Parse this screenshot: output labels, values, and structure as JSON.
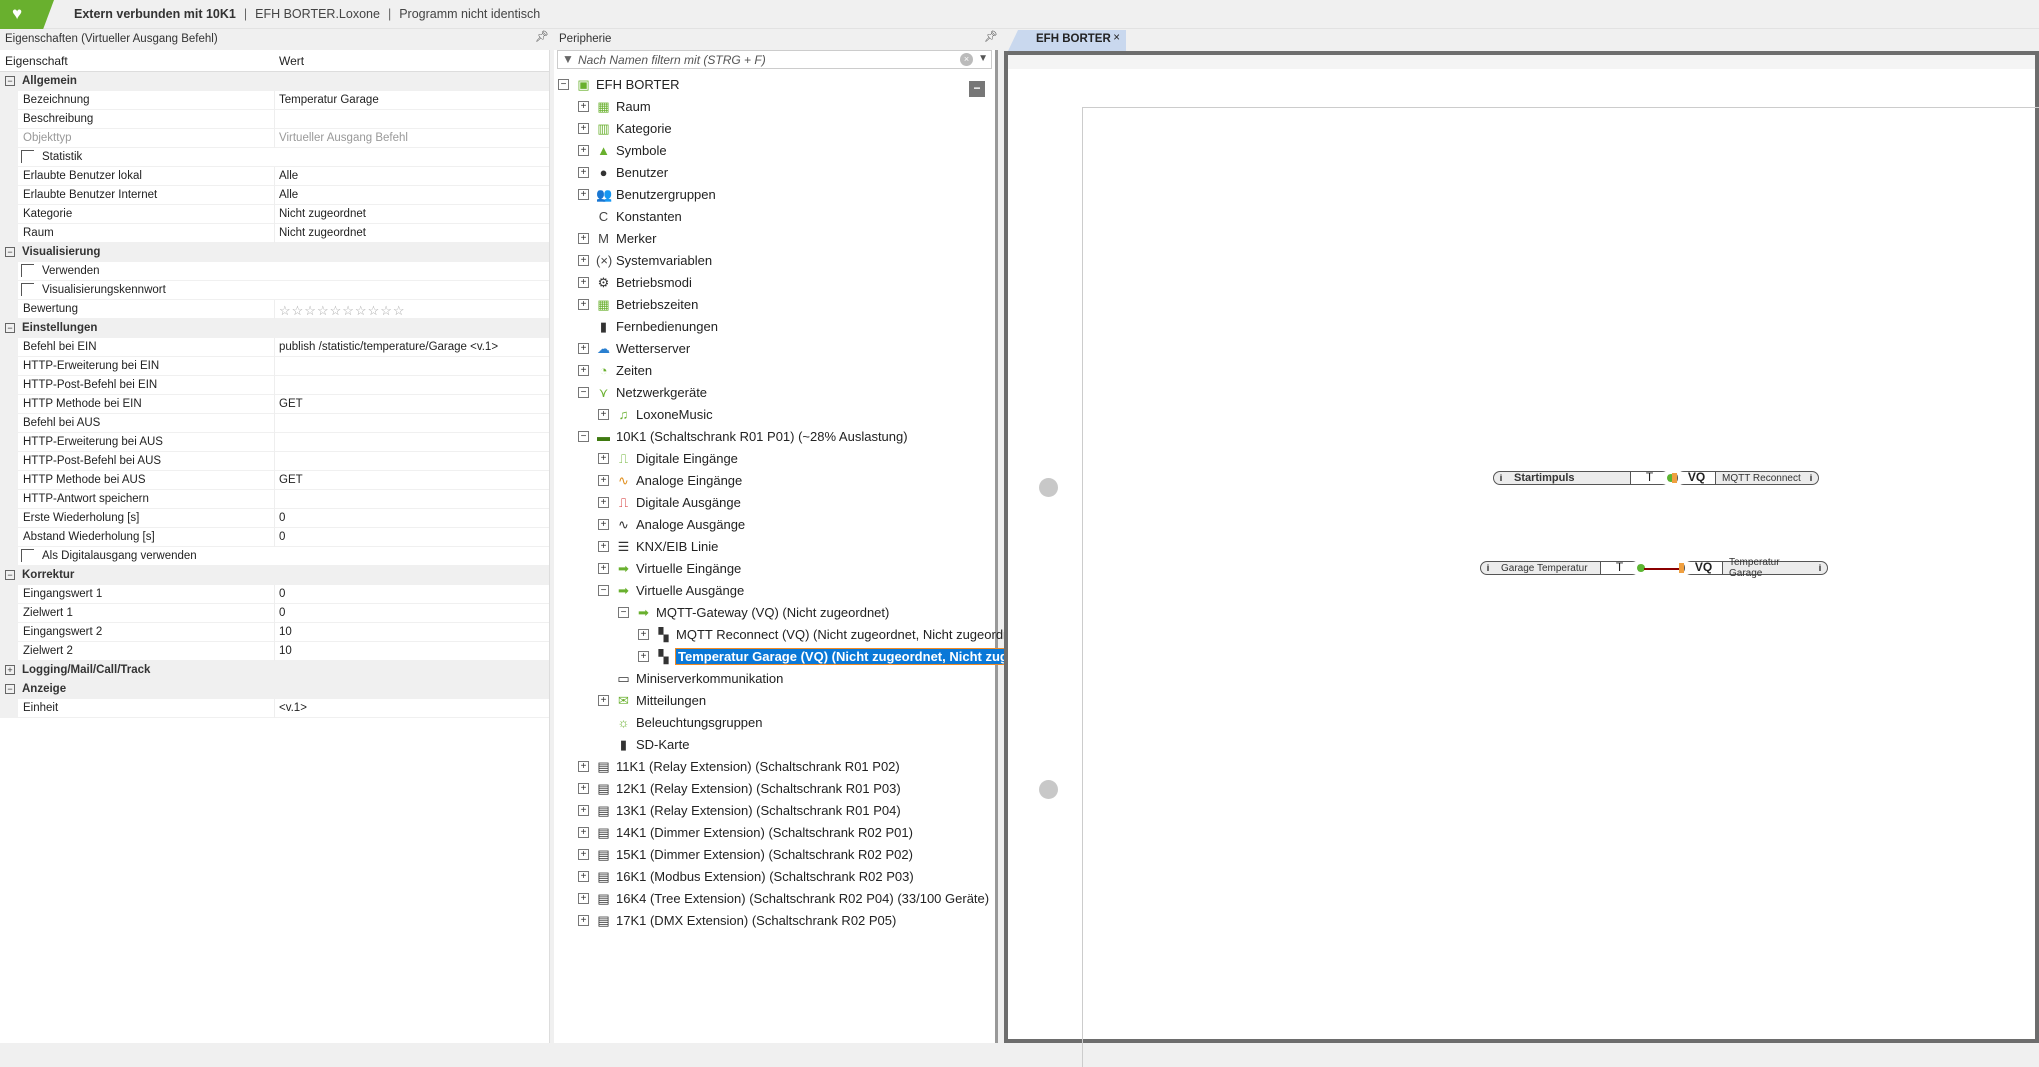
{
  "topbar": {
    "connection": "Extern verbunden mit 10K1",
    "file": "EFH BORTER.Loxone",
    "program_state": "Programm nicht identisch",
    "separator": "|"
  },
  "properties": {
    "title": "Eigenschaften (Virtueller Ausgang Befehl)",
    "col_name": "Eigenschaft",
    "col_value": "Wert",
    "rows": [
      {
        "type": "group",
        "label": "Allgemein",
        "expander": "−"
      },
      {
        "type": "prop",
        "label": "Bezeichnung",
        "value": "Temperatur Garage"
      },
      {
        "type": "prop",
        "label": "Beschreibung",
        "value": ""
      },
      {
        "type": "prop",
        "label": "Objekttyp",
        "value": "Virtueller Ausgang Befehl",
        "disabled": true
      },
      {
        "type": "check",
        "label": "Statistik",
        "checked": false
      },
      {
        "type": "prop",
        "label": "Erlaubte Benutzer lokal",
        "value": "Alle"
      },
      {
        "type": "prop",
        "label": "Erlaubte Benutzer Internet",
        "value": "Alle"
      },
      {
        "type": "prop",
        "label": "Kategorie",
        "value": "Nicht zugeordnet"
      },
      {
        "type": "prop",
        "label": "Raum",
        "value": "Nicht zugeordnet"
      },
      {
        "type": "group",
        "label": "Visualisierung",
        "expander": "−"
      },
      {
        "type": "check",
        "label": "Verwenden",
        "checked": false
      },
      {
        "type": "check",
        "label": "Visualisierungskennwort",
        "checked": false
      },
      {
        "type": "prop",
        "label": "Bewertung",
        "value": "☆☆☆☆☆☆☆☆☆☆",
        "rating": 0,
        "rating_max": 10
      },
      {
        "type": "group",
        "label": "Einstellungen",
        "expander": "−"
      },
      {
        "type": "prop",
        "label": "Befehl bei EIN",
        "value": "publish /statistic/temperature/Garage <v.1>"
      },
      {
        "type": "prop",
        "label": "HTTP-Erweiterung bei EIN",
        "value": ""
      },
      {
        "type": "prop",
        "label": "HTTP-Post-Befehl bei EIN",
        "value": ""
      },
      {
        "type": "prop",
        "label": "HTTP Methode bei EIN",
        "value": "GET"
      },
      {
        "type": "prop",
        "label": "Befehl bei AUS",
        "value": ""
      },
      {
        "type": "prop",
        "label": "HTTP-Erweiterung bei AUS",
        "value": ""
      },
      {
        "type": "prop",
        "label": "HTTP-Post-Befehl bei AUS",
        "value": ""
      },
      {
        "type": "prop",
        "label": "HTTP Methode bei AUS",
        "value": "GET"
      },
      {
        "type": "prop",
        "label": "HTTP-Antwort speichern",
        "value": ""
      },
      {
        "type": "prop",
        "label": "Erste Wiederholung [s]",
        "value": "0"
      },
      {
        "type": "prop",
        "label": "Abstand Wiederholung [s]",
        "value": "0"
      },
      {
        "type": "check",
        "label": "Als Digitalausgang verwenden",
        "checked": false
      },
      {
        "type": "group",
        "label": "Korrektur",
        "expander": "−"
      },
      {
        "type": "prop",
        "label": "Eingangswert 1",
        "value": "0"
      },
      {
        "type": "prop",
        "label": "Zielwert 1",
        "value": "0"
      },
      {
        "type": "prop",
        "label": "Eingangswert 2",
        "value": "10"
      },
      {
        "type": "prop",
        "label": "Zielwert 2",
        "value": "10"
      },
      {
        "type": "group",
        "label": "Logging/Mail/Call/Track",
        "expander": "+"
      },
      {
        "type": "group",
        "label": "Anzeige",
        "expander": "−"
      },
      {
        "type": "prop",
        "label": "Einheit",
        "value": "<v.1>"
      }
    ]
  },
  "peripherie": {
    "title": "Peripherie",
    "filter_placeholder": "Nach Namen filtern mit (STRG + F)",
    "items": [
      {
        "d": 0,
        "x": "−",
        "icon": "project-icon",
        "g": "▣",
        "c": "#69b02e",
        "label": "EFH BORTER"
      },
      {
        "d": 1,
        "x": "+",
        "icon": "room-icon",
        "g": "▦",
        "c": "#69b02e",
        "label": "Raum"
      },
      {
        "d": 1,
        "x": "+",
        "icon": "category-icon",
        "g": "▥",
        "c": "#69b02e",
        "label": "Kategorie"
      },
      {
        "d": 1,
        "x": "+",
        "icon": "symbols-icon",
        "g": "▲",
        "c": "#69b02e",
        "label": "Symbole"
      },
      {
        "d": 1,
        "x": "+",
        "icon": "user-icon",
        "g": "●",
        "c": "#333",
        "label": "Benutzer"
      },
      {
        "d": 1,
        "x": "+",
        "icon": "user-group-icon",
        "g": "👥",
        "c": "#333",
        "label": "Benutzergruppen"
      },
      {
        "d": 1,
        "x": "",
        "icon": "constant-icon",
        "g": "C",
        "c": "#444",
        "label": "Konstanten"
      },
      {
        "d": 1,
        "x": "+",
        "icon": "flag-icon",
        "g": "M",
        "c": "#444",
        "label": "Merker"
      },
      {
        "d": 1,
        "x": "+",
        "icon": "system-variable-icon",
        "g": "(×)",
        "c": "#444",
        "label": "Systemvariablen"
      },
      {
        "d": 1,
        "x": "+",
        "icon": "gear-icon",
        "g": "⚙",
        "c": "#333",
        "label": "Betriebsmodi"
      },
      {
        "d": 1,
        "x": "+",
        "icon": "calendar-icon",
        "g": "▦",
        "c": "#69b02e",
        "label": "Betriebszeiten"
      },
      {
        "d": 1,
        "x": "",
        "icon": "remote-icon",
        "g": "▮",
        "c": "#333",
        "label": "Fernbedienungen"
      },
      {
        "d": 1,
        "x": "+",
        "icon": "weather-icon",
        "g": "☁",
        "c": "#2a7fd0",
        "label": "Wetterserver"
      },
      {
        "d": 1,
        "x": "+",
        "icon": "clock-icon",
        "g": "◔",
        "c": "#69b02e",
        "label": "Zeiten"
      },
      {
        "d": 1,
        "x": "−",
        "icon": "network-icon",
        "g": "⋎",
        "c": "#69b02e",
        "label": "Netzwerkgeräte"
      },
      {
        "d": 2,
        "x": "+",
        "icon": "music-icon",
        "g": "♫",
        "c": "#69b02e",
        "label": "LoxoneMusic"
      },
      {
        "d": 1,
        "x": "−",
        "icon": "miniserver-icon",
        "g": "▬",
        "c": "#3f7a10",
        "label": "10K1 (Schaltschrank R01 P01) (~28% Auslastung)"
      },
      {
        "d": 2,
        "x": "+",
        "icon": "digital-input-icon",
        "g": "⎍",
        "c": "#69b02e",
        "label": "Digitale Eingänge"
      },
      {
        "d": 2,
        "x": "+",
        "icon": "analog-input-icon",
        "g": "∿",
        "c": "#e09020",
        "label": "Analoge Eingänge"
      },
      {
        "d": 2,
        "x": "+",
        "icon": "digital-output-icon",
        "g": "⎍",
        "c": "#d02020",
        "label": "Digitale Ausgänge"
      },
      {
        "d": 2,
        "x": "+",
        "icon": "analog-output-icon",
        "g": "∿",
        "c": "#333",
        "label": "Analoge Ausgänge"
      },
      {
        "d": 2,
        "x": "+",
        "icon": "knx-icon",
        "g": "☰",
        "c": "#333",
        "label": "KNX/EIB Linie"
      },
      {
        "d": 2,
        "x": "+",
        "icon": "virtual-input-icon",
        "g": "➡",
        "c": "#69b02e",
        "label": "Virtuelle Eingänge"
      },
      {
        "d": 2,
        "x": "−",
        "icon": "virtual-output-icon",
        "g": "➡",
        "c": "#69b02e",
        "label": "Virtuelle Ausgänge"
      },
      {
        "d": 3,
        "x": "−",
        "icon": "virtual-output-icon",
        "g": "➡",
        "c": "#69b02e",
        "label": "MQTT-Gateway (VQ) (Nicht zugeordnet)"
      },
      {
        "d": 4,
        "x": "+",
        "icon": "command-icon",
        "g": "▚",
        "c": "#333",
        "label": "MQTT Reconnect (VQ) (Nicht zugeordnet, Nicht zugeordnet)"
      },
      {
        "d": 4,
        "x": "+",
        "icon": "command-icon",
        "g": "▚",
        "c": "#333",
        "label": "Temperatur Garage (VQ) (Nicht zugeordnet, Nicht zugeordnet)",
        "selected": true
      },
      {
        "d": 2,
        "x": "",
        "icon": "miniserver-comm-icon",
        "g": "▭",
        "c": "#333",
        "label": "Miniserverkommunikation"
      },
      {
        "d": 2,
        "x": "+",
        "icon": "messages-icon",
        "g": "✉",
        "c": "#69b02e",
        "label": "Mitteilungen"
      },
      {
        "d": 2,
        "x": "",
        "icon": "lighting-group-icon",
        "g": "☼",
        "c": "#69b02e",
        "label": "Beleuchtungsgruppen"
      },
      {
        "d": 2,
        "x": "",
        "icon": "sd-card-icon",
        "g": "▮",
        "c": "#333",
        "label": "SD-Karte"
      },
      {
        "d": 1,
        "x": "+",
        "icon": "extension-icon",
        "g": "▤",
        "c": "#333",
        "label": "11K1 (Relay Extension) (Schaltschrank R01 P02)"
      },
      {
        "d": 1,
        "x": "+",
        "icon": "extension-icon",
        "g": "▤",
        "c": "#333",
        "label": "12K1 (Relay Extension) (Schaltschrank R01 P03)"
      },
      {
        "d": 1,
        "x": "+",
        "icon": "extension-icon",
        "g": "▤",
        "c": "#333",
        "label": "13K1 (Relay Extension) (Schaltschrank R01 P04)"
      },
      {
        "d": 1,
        "x": "+",
        "icon": "extension-icon",
        "g": "▤",
        "c": "#333",
        "label": "14K1 (Dimmer Extension) (Schaltschrank R02 P01)"
      },
      {
        "d": 1,
        "x": "+",
        "icon": "extension-icon",
        "g": "▤",
        "c": "#333",
        "label": "15K1 (Dimmer Extension) (Schaltschrank R02 P02)"
      },
      {
        "d": 1,
        "x": "+",
        "icon": "extension-icon",
        "g": "▤",
        "c": "#333",
        "label": "16K1 (Modbus Extension) (Schaltschrank R02 P03)"
      },
      {
        "d": 1,
        "x": "+",
        "icon": "extension-icon",
        "g": "▤",
        "c": "#333",
        "label": "16K4 (Tree Extension) (Schaltschrank R02 P04) (33/100 Geräte)"
      },
      {
        "d": 1,
        "x": "+",
        "icon": "extension-icon",
        "g": "▤",
        "c": "#333",
        "label": "17K1 (DMX Extension) (Schaltschrank R02 P05)"
      }
    ]
  },
  "document_tab": {
    "label": "EFH BORTER",
    "close": "×"
  },
  "canvas": {
    "blocks": [
      {
        "input": "Startimpuls",
        "input_type": "T",
        "output_type": "VQ",
        "output": "MQTT Reconnect",
        "wire_color": "#333333"
      },
      {
        "input": "Garage Temperatur",
        "input_type": "T",
        "output_type": "VQ",
        "output": "Temperatur Garage",
        "wire_color": "#8b0000"
      }
    ],
    "info_glyph": "i"
  }
}
